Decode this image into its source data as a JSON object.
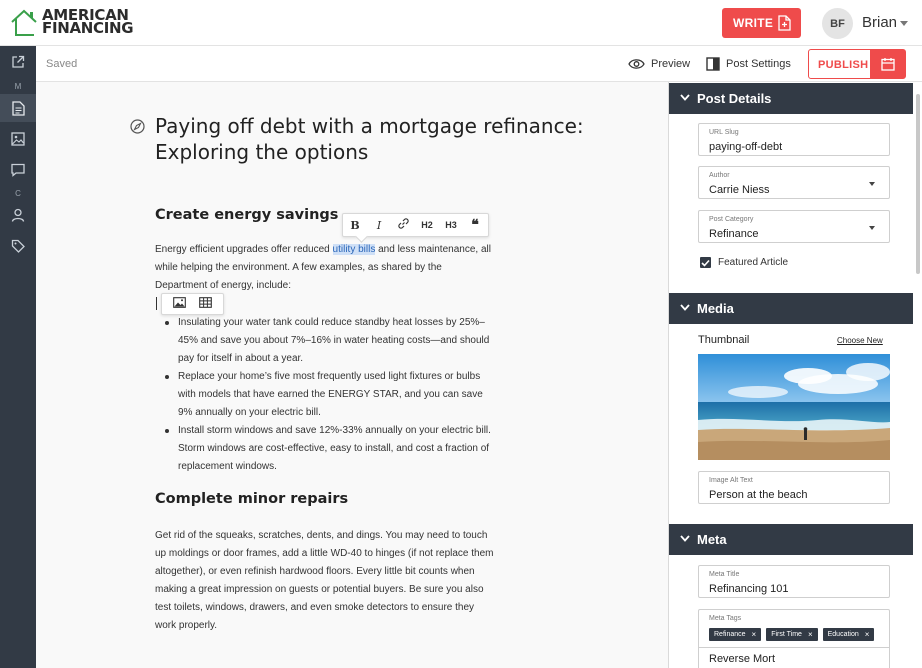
{
  "header": {
    "logo_line1": "AMERICAN",
    "logo_line2": "FINANCING",
    "write_label": "WRITE",
    "user_initials": "BF",
    "user_name": "Brian"
  },
  "sidebar": {
    "items": [
      {
        "icon": "external-link-icon"
      },
      {
        "letter": "M"
      },
      {
        "icon": "document-icon",
        "active": true
      },
      {
        "icon": "image-icon"
      },
      {
        "icon": "comment-icon"
      },
      {
        "letter": "C"
      },
      {
        "icon": "user-icon"
      },
      {
        "icon": "tag-icon"
      }
    ]
  },
  "toolbar": {
    "status": "Saved",
    "preview_label": "Preview",
    "post_settings_label": "Post Settings",
    "publish_label": "PUBLISH"
  },
  "editor": {
    "title": "Paying off debt with a mortgage refinance: Exploring the options",
    "heading1": "Create energy savings",
    "para1_before": "Energy efficient upgrades offer reduced ",
    "para1_highlight": "utility bills",
    "para1_after": " and less maintenance, all while helping the environment. A few examples, as shared by the Department of energy, include:",
    "bullets": [
      "Insulating your water tank could reduce standby heat losses by 25%–45% and save you about 7%–16% in water heating costs—and should pay for itself in about a year.",
      "Replace your home’s five most frequently used light fixtures or bulbs with models that have earned the ENERGY STAR, and you can save 9% annually on your electric bill.",
      "Install storm windows and save 12%-33% annually on your electric bill. Storm windows are cost-effective, easy to install, and cost a fraction of replacement windows."
    ],
    "heading2": "Complete minor repairs",
    "para2": "Get rid of the squeaks, scratches, dents, and dings. You may need to touch up moldings or door frames, add a little WD-40 to hinges (if not replace them altogether), or even refinish hardwood floors.  Every little bit counts when making a great impression on guests or potential buyers. Be sure you also test toilets, windows, drawers, and even smoke detectors to ensure they work properly.",
    "format_toolbar": {
      "bold": "B",
      "italic": "I",
      "h2": "H2",
      "h3": "H3",
      "quote": "❝"
    }
  },
  "post_details": {
    "section_title": "Post Details",
    "url_slug_label": "URL Slug",
    "url_slug_value": "paying-off-debt",
    "author_label": "Author",
    "author_value": "Carrie Niess",
    "category_label": "Post Category",
    "category_value": "Refinance",
    "featured_label": "Featured Article",
    "featured_checked": true
  },
  "media": {
    "section_title": "Media",
    "thumbnail_label": "Thumbnail",
    "choose_new_label": "Choose New",
    "alt_text_label": "Image Alt Text",
    "alt_text_value": "Person at the beach"
  },
  "meta": {
    "section_title": "Meta",
    "meta_title_label": "Meta Title",
    "meta_title_value": "Refinancing 101",
    "meta_tags_label": "Meta Tags",
    "tags": [
      "Refinance",
      "First Time",
      "Education"
    ],
    "tag_input_value": "Reverse Mort"
  },
  "colors": {
    "accent": "#ef4b4b",
    "dark": "#323a45",
    "logo_green": "#3aa04a",
    "highlight": "#cfe0f7"
  }
}
